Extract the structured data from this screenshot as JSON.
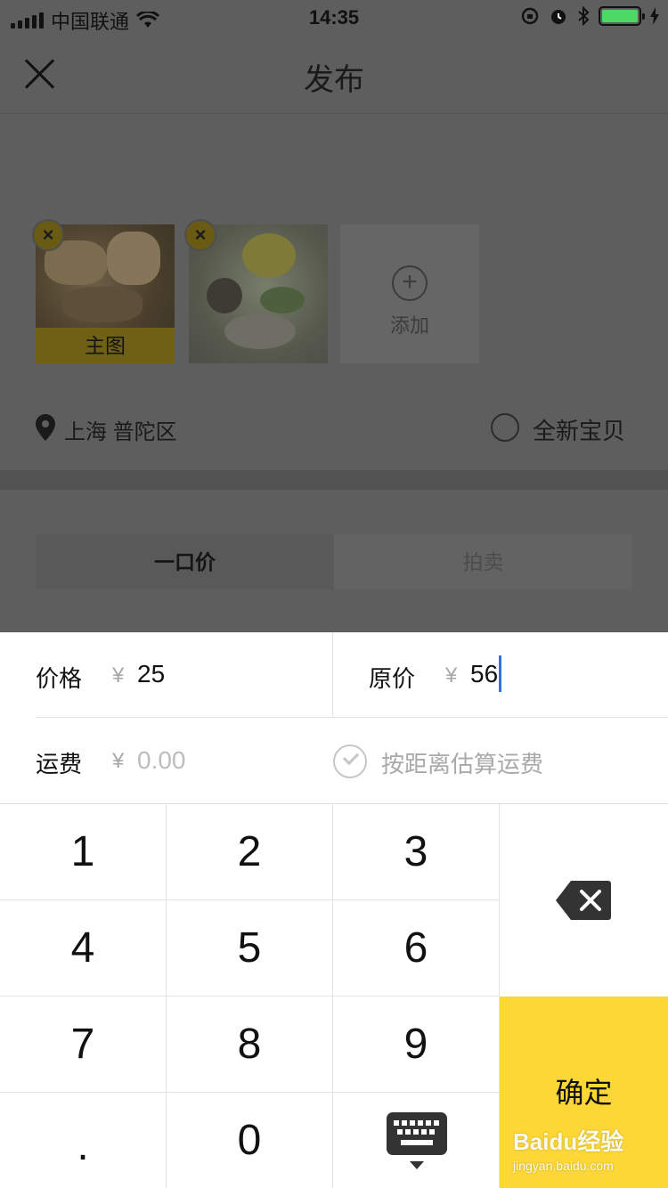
{
  "status_bar": {
    "carrier": "中国联通",
    "time": "14:35"
  },
  "nav": {
    "title": "发布"
  },
  "photos": {
    "main_label": "主图",
    "remove_symbol": "×",
    "add_symbol": "+",
    "add_label": "添加"
  },
  "location": {
    "text": "上海 普陀区",
    "new_item_label": "全新宝贝"
  },
  "segment": {
    "tabs": [
      "一口价",
      "拍卖"
    ]
  },
  "price": {
    "price_label": "价格",
    "currency": "¥",
    "price_value": "25",
    "original_label": "原价",
    "original_value": "56",
    "shipping_label": "运费",
    "shipping_placeholder": "0.00",
    "estimate_label": "按距离估算运费"
  },
  "keypad": {
    "keys": [
      "1",
      "2",
      "3",
      "4",
      "5",
      "6",
      "7",
      "8",
      "9",
      ".",
      "0"
    ],
    "confirm": "确定"
  },
  "watermark": {
    "text": "Baidu经验",
    "url": "jingyan.baidu.com"
  },
  "colors": {
    "accent": "#fcd736",
    "cursor": "#3b6fe0",
    "overlay": "#5e5e5e"
  }
}
